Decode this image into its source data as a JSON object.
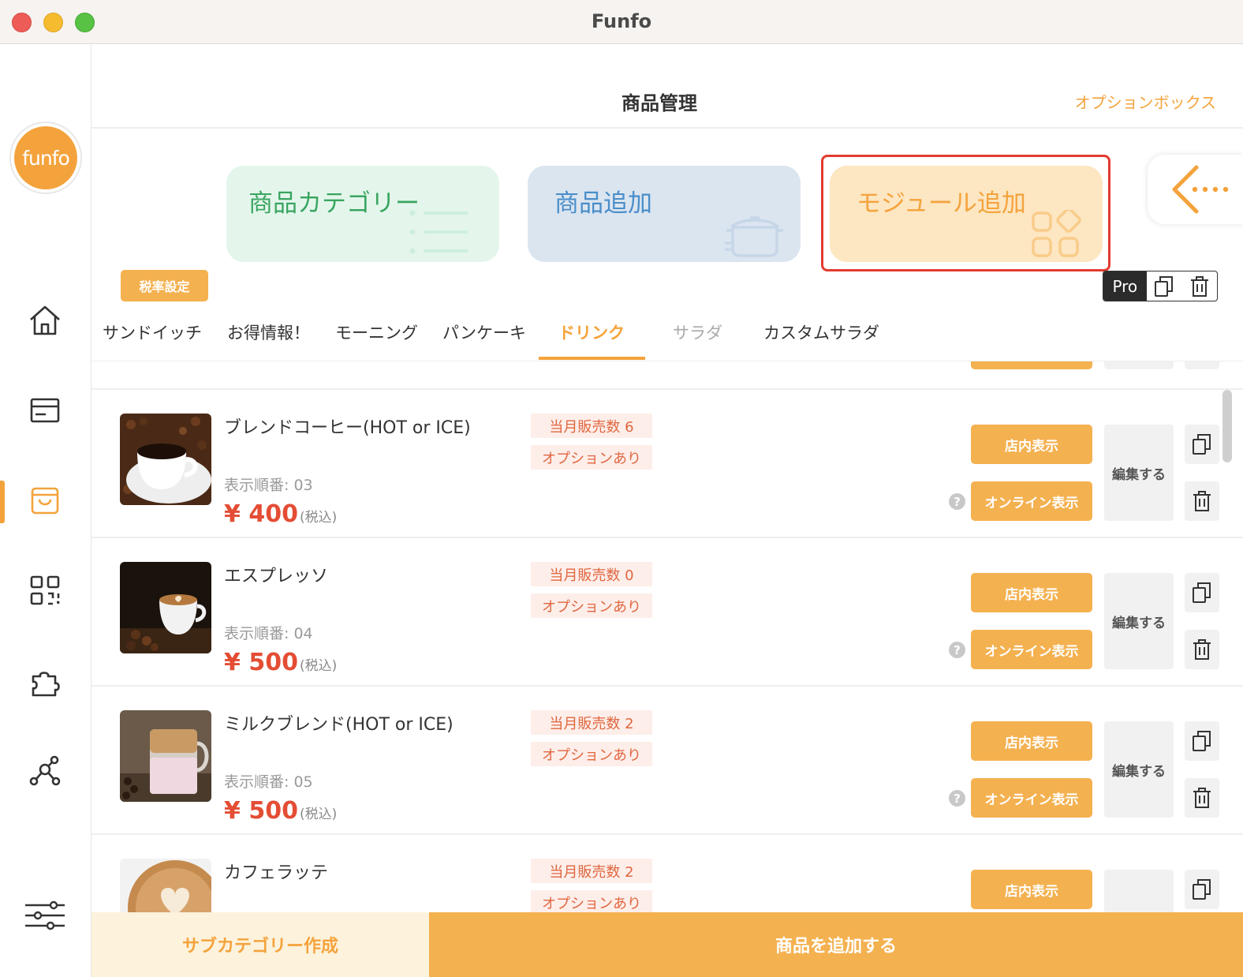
{
  "window": {
    "title": "Funfo"
  },
  "sidebar": {
    "logo_text": "funfo"
  },
  "header": {
    "title": "商品管理",
    "option_box": "オプションボックス"
  },
  "cards": {
    "category": "商品カテゴリー",
    "add_product": "商品追加",
    "add_module": "モジュール追加"
  },
  "toolbar": {
    "tax_setting": "税率設定",
    "pro_label": "Pro"
  },
  "tabs": [
    {
      "label": "サンドイッチ"
    },
    {
      "label": "お得情報！"
    },
    {
      "label": "モーニング"
    },
    {
      "label": "パンケーキ"
    },
    {
      "label": "ドリンク"
    },
    {
      "label": "サラダ"
    },
    {
      "label": "カスタムサラダ"
    }
  ],
  "actions": {
    "store_display": "店内表示",
    "online_display": "オンライン表示",
    "edit": "編集する",
    "help": "?"
  },
  "products": [
    {
      "name": "ブレンドコーヒー(HOT or ICE)",
      "order": "表示順番: 03",
      "price": "¥ 400",
      "tax": "(税込)",
      "sales": "当月販売数 6",
      "option": "オプションあり"
    },
    {
      "name": "エスプレッソ",
      "order": "表示順番: 04",
      "price": "¥ 500",
      "tax": "(税込)",
      "sales": "当月販売数 0",
      "option": "オプションあり"
    },
    {
      "name": "ミルクブレンド(HOT or ICE)",
      "order": "表示順番: 05",
      "price": "¥ 500",
      "tax": "(税込)",
      "sales": "当月販売数 2",
      "option": "オプションあり"
    },
    {
      "name": "カフェラッテ",
      "sales": "当月販売数 2",
      "option": "オプションあり"
    }
  ],
  "bottom": {
    "create_subcategory": "サブカテゴリー作成",
    "add_product": "商品を追加する"
  },
  "colors": {
    "accent": "#f4a33c",
    "price": "#e44d34",
    "highlight": "#e23b2f"
  }
}
